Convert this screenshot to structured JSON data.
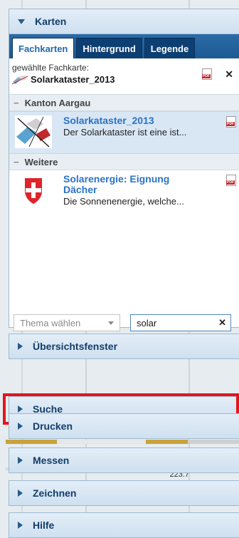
{
  "karten_panel": {
    "title": "Karten",
    "tabs": [
      {
        "label": "Fachkarten",
        "active": true
      },
      {
        "label": "Hintergrund",
        "active": false
      },
      {
        "label": "Legende",
        "active": false
      }
    ],
    "selected_label": "gewählte Fachkarte:",
    "selected_name": "Solarkataster_2013",
    "groups": [
      {
        "title": "Kanton Aargau",
        "items": [
          {
            "title": "Solarkataster_2013",
            "desc": "Der Solarkataster ist eine ist..."
          }
        ]
      },
      {
        "title": "Weitere",
        "items": [
          {
            "title": "Solarenergie: Eignung Dächer",
            "desc": "Die Sonnenenergie, welche..."
          }
        ]
      }
    ],
    "theme_select_placeholder": "Thema wählen",
    "search_value": "solar"
  },
  "collapsed_panels": [
    {
      "title": "Übersichtsfenster"
    },
    {
      "title": "Suche",
      "highlighted": true
    },
    {
      "title": "Drucken"
    },
    {
      "title": "Messen"
    },
    {
      "title": "Zeichnen"
    },
    {
      "title": "Hilfe"
    }
  ],
  "map_label": "223.7",
  "colors": {
    "accent": "#2169ad",
    "header_text": "#123d6b",
    "highlight_frame": "#e4151d",
    "selected_row": "#d9e7f5"
  }
}
